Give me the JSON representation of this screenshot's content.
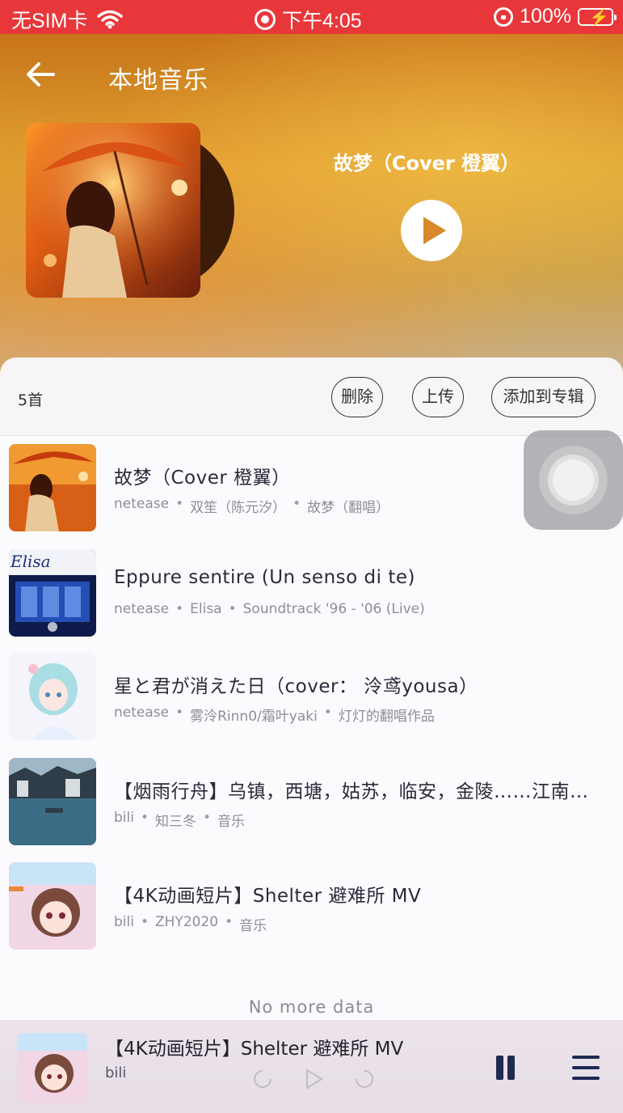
{
  "status_bar": {
    "carrier": "无SIM卡",
    "time": "下午4:05",
    "battery": "100%"
  },
  "header": {
    "title": "本地音乐",
    "now_playing_title": "故梦（Cover 橙翼）"
  },
  "toolbar": {
    "count": "5首",
    "delete_label": "删除",
    "upload_label": "上传",
    "add_to_album_label": "添加到专辑"
  },
  "songs": [
    {
      "title": "故梦（Cover 橙翼）",
      "meta": [
        "netease",
        "双笙（陈元汐）",
        "故梦（翻唱）"
      ]
    },
    {
      "title": "Eppure sentire (Un senso di te)",
      "meta": [
        "netease",
        "Elisa",
        "Soundtrack '96 - '06 (Live)"
      ],
      "thumb_text": "Elisa"
    },
    {
      "title": "星と君が消えた日（cover： 泠鸢yousa）",
      "meta": [
        "netease",
        "雾泠Rinn0/霜叶yaki",
        "灯灯的翻唱作品"
      ]
    },
    {
      "title": "【烟雨行舟】乌镇，西塘，姑苏，临安，金陵……江南…",
      "meta": [
        "bili",
        "知三冬",
        "音乐"
      ]
    },
    {
      "title": "【4K动画短片】Shelter 避难所 MV",
      "meta": [
        "bili",
        "ZHY2020",
        "音乐"
      ]
    }
  ],
  "list_footer": "No more data",
  "mini_player": {
    "title": "【4K动画短片】Shelter 避难所 MV",
    "source": "bili"
  },
  "colors": {
    "status_bar": "#e8373a",
    "accent_dark": "#1e2a52"
  }
}
